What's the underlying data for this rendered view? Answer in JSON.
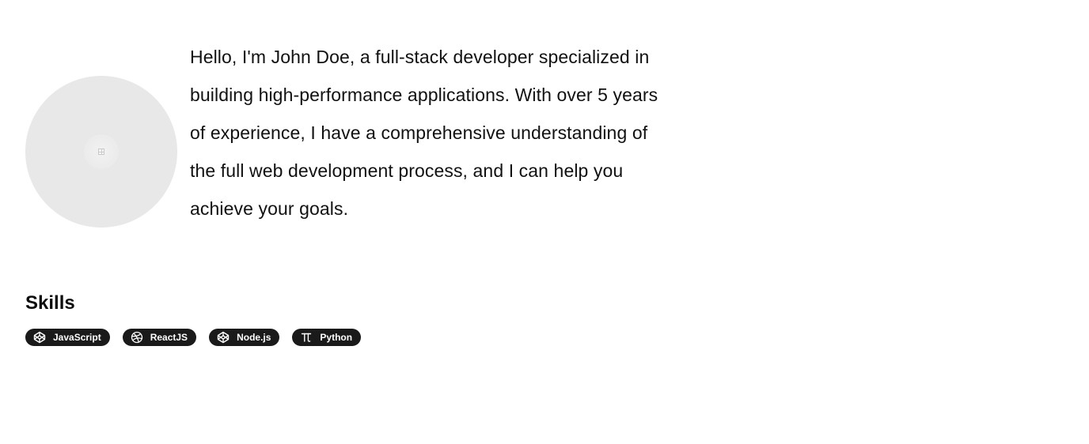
{
  "profile": {
    "avatar_icon": "image-placeholder-icon",
    "bio": "Hello, I'm John Doe, a full-stack developer specialized in building high-performance applications. With over 5 years of experience, I have a comprehensive understanding of the full web development process, and I can help you achieve your goals."
  },
  "skills": {
    "title": "Skills",
    "items": [
      {
        "label": "JavaScript",
        "icon": "codepen-icon"
      },
      {
        "label": "ReactJS",
        "icon": "dribbble-icon"
      },
      {
        "label": "Node.js",
        "icon": "codepen-icon"
      },
      {
        "label": "Python",
        "icon": "pi-icon"
      }
    ]
  },
  "colors": {
    "chip_background": "#1a1a1a",
    "chip_text": "#ffffff",
    "avatar_background": "#e8e8e8",
    "text": "#111111"
  }
}
